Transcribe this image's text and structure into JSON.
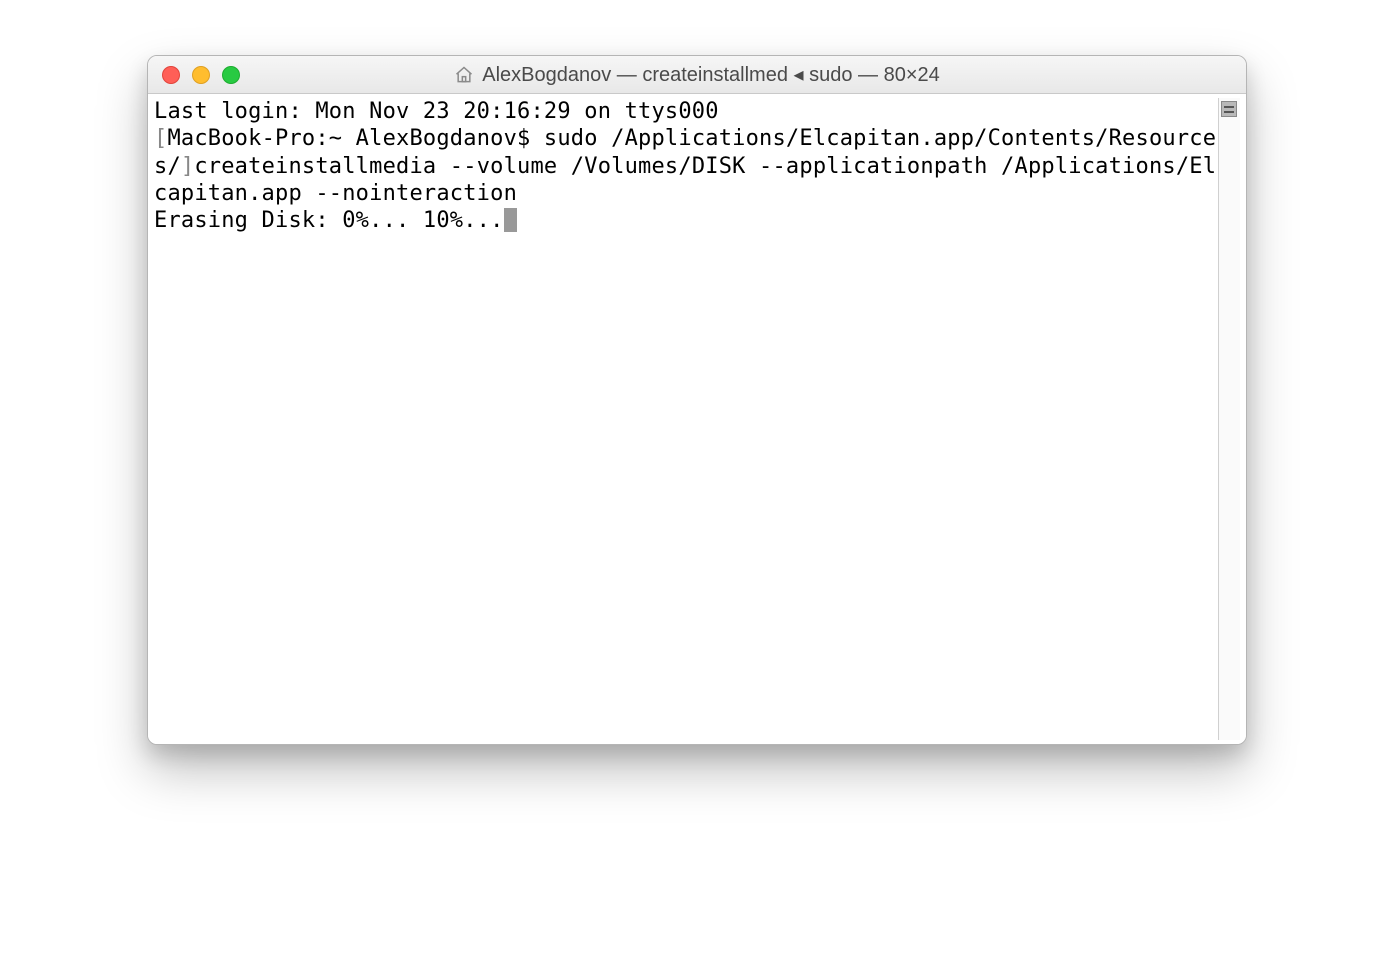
{
  "window": {
    "title": "AlexBogdanov — createinstallmed ◂ sudo — 80×24"
  },
  "terminal": {
    "lines": [
      "Last login: Mon Nov 23 20:16:29 on ttys000",
      "[MacBook-Pro:~ AlexBogdanov$ sudo /Applications/Elcapitan.app/Contents/Resources/]createinstallmedia --volume /Volumes/DISK --applicationpath /Applications/Elcapitan.app --nointeraction",
      "Erasing Disk: 0%... 10%..."
    ],
    "line0": "Last login: Mon Nov 23 20:16:29 on ttys000",
    "bracket_open": "[",
    "prompt_inner": "MacBook-Pro:~ AlexBogdanov$ sudo /Applications/Elcapitan.app/Contents/Resources/",
    "bracket_close": "]",
    "wrap_continuation": "createinstallmedia --volume /Volumes/DISK --applicationpath /Applications/Elcapitan.app --nointeraction",
    "progress": "Erasing Disk: 0%... 10%..."
  },
  "colors": {
    "red": "#ff5f57",
    "yellow": "#ffbd2e",
    "green": "#28ca42"
  }
}
